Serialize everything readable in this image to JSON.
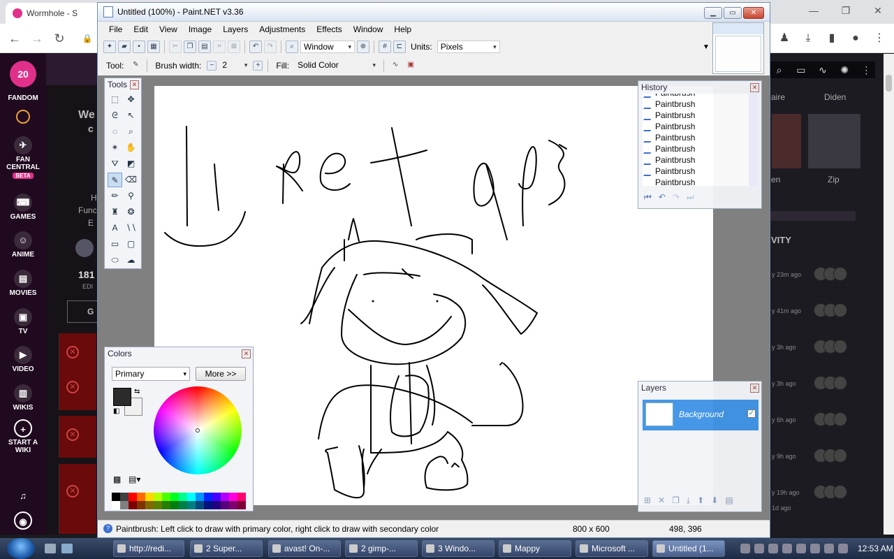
{
  "browser": {
    "tab_title": "Wormhole - S",
    "controls": [
      "—",
      "❐",
      "✕"
    ]
  },
  "fandom": {
    "logo_badge": "20",
    "nav": [
      {
        "label": "FANDOM",
        "icon": "fandom-logo-icon"
      },
      {
        "label": "",
        "icon": "search-icon"
      },
      {
        "label": "FAN CENTRAL",
        "icon": "rocket-icon",
        "badge": "BETA"
      },
      {
        "label": "GAMES",
        "icon": "gamepad-icon"
      },
      {
        "label": "ANIME",
        "icon": "anime-icon"
      },
      {
        "label": "MOVIES",
        "icon": "clapper-icon"
      },
      {
        "label": "TV",
        "icon": "tv-icon"
      },
      {
        "label": "VIDEO",
        "icon": "play-icon"
      },
      {
        "label": "WIKIS",
        "icon": "book-icon"
      },
      {
        "label": "START A WIKI",
        "icon": "plus-circle-icon"
      }
    ],
    "partial_texts": [
      "We",
      "c",
      "H",
      "Func",
      "E",
      "181",
      "EDI",
      "G"
    ],
    "right_labels": [
      "aire",
      "Diden",
      "en",
      "Zip",
      "VITY"
    ],
    "activity_times": [
      "y 23m ago",
      "y 41m ago",
      "y 3h ago",
      "y 3h ago",
      "y 6h ago",
      "y 9h ago",
      "y 19h ago",
      "1d ago"
    ]
  },
  "pdn": {
    "title": "Untitled (100%) - Paint.NET v3.36",
    "menu": [
      "File",
      "Edit",
      "View",
      "Image",
      "Layers",
      "Adjustments",
      "Effects",
      "Window",
      "Help"
    ],
    "toolbar1": {
      "zoom_select": "Window",
      "units_label": "Units:",
      "units_value": "Pixels"
    },
    "toolbar2": {
      "tool_label": "Tool:",
      "brush_width_label": "Brush width:",
      "brush_width_value": "2",
      "fill_label": "Fill:",
      "fill_value": "Solid Color"
    },
    "tools_panel_title": "Tools",
    "history": {
      "title": "History",
      "items": [
        "Paintbrush",
        "Paintbrush",
        "Paintbrush",
        "Paintbrush",
        "Paintbrush",
        "Paintbrush",
        "Paintbrush",
        "Paintbrush",
        "Paintbrush",
        "Paintbrush"
      ]
    },
    "colors": {
      "title": "Colors",
      "mode": "Primary",
      "more_button": "More >>",
      "primary": "#2b2b2b",
      "secondary": "#f0f0f0",
      "palette": [
        "#000000",
        "#404040",
        "#ff0000",
        "#ff6a00",
        "#ffd800",
        "#b6ff00",
        "#4cff00",
        "#00ff21",
        "#00ff90",
        "#00ffff",
        "#0094ff",
        "#0026ff",
        "#4800ff",
        "#b200ff",
        "#ff00dc",
        "#ff006e",
        "#ffffff",
        "#808080",
        "#7f0000",
        "#7f3300",
        "#7f6a00",
        "#5b7f00",
        "#267f00",
        "#007f0e",
        "#007f46",
        "#007f7f",
        "#004a7f",
        "#00137f",
        "#21007f",
        "#57007f",
        "#7f006e",
        "#7f0037"
      ]
    },
    "layers": {
      "title": "Layers",
      "layer_name": "Background",
      "checkmark": "✓"
    },
    "status": {
      "text": "Paintbrush: Left click to draw with primary color, right click to draw with secondary color",
      "size": "800 x 600",
      "position": "498, 396"
    }
  },
  "taskbar": {
    "tasks": [
      {
        "label": "http://redi..."
      },
      {
        "label": "2 Super..."
      },
      {
        "label": "avast! On-..."
      },
      {
        "label": "2 gimp-..."
      },
      {
        "label": "3 Windo..."
      },
      {
        "label": "Mappy"
      },
      {
        "label": "Microsoft ..."
      },
      {
        "label": "Untitled (1..."
      }
    ],
    "clock": "12:53 AM"
  }
}
